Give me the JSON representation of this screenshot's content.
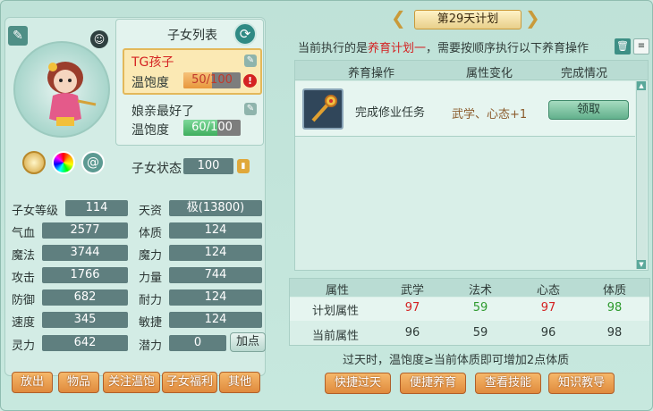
{
  "colors": {
    "red": "#d42222",
    "green": "#2e9a2e",
    "panel": "#d9efe8"
  },
  "portrait": {
    "icon": "child-portrait"
  },
  "child_list": {
    "title": "子女列表",
    "items": [
      {
        "name": "TG孩子",
        "sat_label": "温饱度",
        "sat_value": "50/100",
        "selected": true,
        "warn": true
      },
      {
        "name": "娘亲最好了",
        "sat_label": "温饱度",
        "sat_value": "60/100",
        "selected": false,
        "warn": false
      }
    ]
  },
  "child_status": {
    "label": "子女状态",
    "value": "100"
  },
  "stats": {
    "left": [
      {
        "label": "子女等级",
        "value": "114"
      },
      {
        "label": "气血",
        "value": "2577"
      },
      {
        "label": "魔法",
        "value": "3744"
      },
      {
        "label": "攻击",
        "value": "1766"
      },
      {
        "label": "防御",
        "value": "682"
      },
      {
        "label": "速度",
        "value": "345"
      },
      {
        "label": "灵力",
        "value": "642"
      }
    ],
    "right": [
      {
        "label": "天资",
        "value": "极(13800)"
      },
      {
        "label": "体质",
        "value": "124"
      },
      {
        "label": "魔力",
        "value": "124"
      },
      {
        "label": "力量",
        "value": "744"
      },
      {
        "label": "耐力",
        "value": "124"
      },
      {
        "label": "敏捷",
        "value": "124"
      },
      {
        "label": "潜力",
        "value": "0"
      }
    ],
    "add_point": "加点"
  },
  "bottom_left_buttons": [
    "放出",
    "物品",
    "关注温饱",
    "子女福利",
    "其他"
  ],
  "plan": {
    "day_title": "第29天计划",
    "desc_prefix": "当前执行的是",
    "desc_plan": "养育计划一",
    "desc_suffix": "，需要按顺序执行以下养育操作",
    "headers": [
      "养育操作",
      "属性变化",
      "完成情况"
    ],
    "tasks": [
      {
        "name": "完成修业任务",
        "change": "武学、心态+1",
        "action": "领取",
        "icon": "scepter-icon"
      }
    ]
  },
  "attr_table": {
    "headers": [
      "属性",
      "武学",
      "法术",
      "心态",
      "体质"
    ],
    "rows": [
      {
        "label": "计划属性",
        "values": [
          "97",
          "59",
          "97",
          "98"
        ],
        "colors": [
          "red",
          "green",
          "red",
          "green"
        ]
      },
      {
        "label": "当前属性",
        "values": [
          "96",
          "59",
          "96",
          "98"
        ]
      }
    ],
    "note": "过天时，温饱度≥当前体质即可增加2点体质"
  },
  "bottom_right_buttons": [
    "快捷过天",
    "便捷养育",
    "查看技能",
    "知识教导"
  ]
}
